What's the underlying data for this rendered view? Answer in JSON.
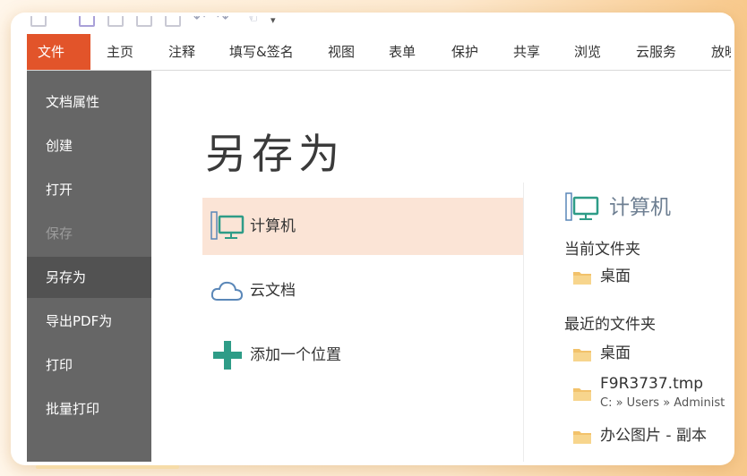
{
  "ribbon": {
    "tabs": [
      "文件",
      "主页",
      "注释",
      "填写&签名",
      "视图",
      "表单",
      "保护",
      "共享",
      "浏览",
      "云服务",
      "放映"
    ]
  },
  "sidebar": {
    "items": [
      {
        "label": "文档属性",
        "state": "normal"
      },
      {
        "label": "创建",
        "state": "normal"
      },
      {
        "label": "打开",
        "state": "normal"
      },
      {
        "label": "保存",
        "state": "disabled"
      },
      {
        "label": "另存为",
        "state": "active"
      },
      {
        "label": "导出PDF为",
        "state": "normal"
      },
      {
        "label": "打印",
        "state": "normal"
      },
      {
        "label": "批量打印",
        "state": "normal"
      }
    ]
  },
  "main": {
    "title": "另存为",
    "options": [
      {
        "label": "计算机",
        "icon": "computer-icon",
        "selected": true
      },
      {
        "label": "云文档",
        "icon": "cloud-icon",
        "selected": false
      },
      {
        "label": "添加一个位置",
        "icon": "plus-icon",
        "selected": false
      }
    ]
  },
  "panel": {
    "heading": "计算机",
    "current_folder_label": "当前文件夹",
    "current_folder": "桌面",
    "recent_label": "最近的文件夹",
    "recent": [
      {
        "name": "桌面",
        "path": ""
      },
      {
        "name": "F9R3737.tmp",
        "path": "C: » Users » Administ"
      },
      {
        "name": "办公图片 - 副本",
        "path": ""
      }
    ]
  },
  "colors": {
    "file_tab": "#e2542a",
    "sidebar": "#666666",
    "sidebar_active": "#525252",
    "selected_option": "#fbe4d6",
    "icon_teal": "#2e9c87",
    "icon_blue": "#5a87b8"
  }
}
